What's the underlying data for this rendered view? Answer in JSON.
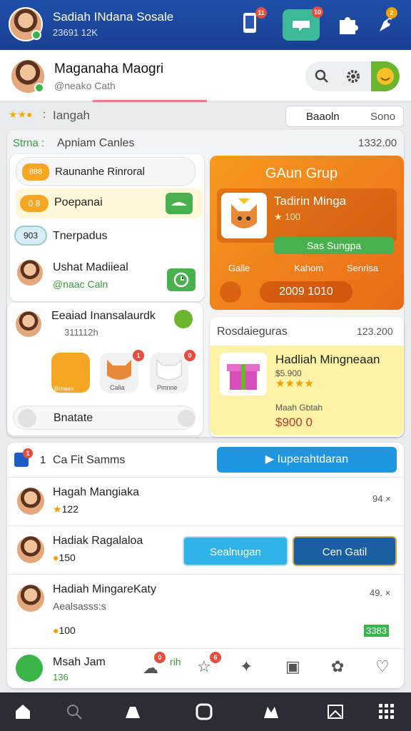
{
  "header": {
    "user_name": "Sadiah INdana Sosale",
    "user_sub": "23691 12K",
    "badges": [
      "11",
      "10",
      "2"
    ]
  },
  "profile": {
    "name": "Maganaha Maogri",
    "sub": "@neako Cath"
  },
  "filter": {
    "label": "Iangah",
    "tab_left": "Baaoln",
    "tab_right": "Sono"
  },
  "panel": {
    "title_green": "Strna :",
    "title": "Apniam Canles",
    "count": "1332.00",
    "items": [
      {
        "label": "Raunanhe Rinroral",
        "chip": "888"
      },
      {
        "label": "Poepanai",
        "chip": "0 8"
      },
      {
        "label": "Tnerpadus",
        "chip": "903"
      },
      {
        "label": "Ushat Madiieal",
        "sub": "@naac Caln"
      }
    ]
  },
  "promo": {
    "title": "GAun Grup",
    "item_title": "Tadirin Minga",
    "item_stars": "★ 100",
    "btn": "Sas Sungpa",
    "tags": [
      "Galle",
      "Kahom",
      "Senrisa"
    ],
    "amount": "2009 1010"
  },
  "people": {
    "name": "Eeaiad Inansalaurdk",
    "sub": "311112h",
    "pets": [
      "Bcnaau",
      "Calia",
      "Pmnne"
    ],
    "pet_badges": [
      "1",
      "0"
    ],
    "footer": "Bnatate"
  },
  "reward": {
    "title": "Rosdaieguras",
    "count": "123.200",
    "name": "Hadliah Mingneaan",
    "price_old": "$5.900",
    "sub": "Maah Gbtah",
    "price": "$900 0"
  },
  "list": {
    "head_icon_num": "1",
    "head_num": "1",
    "head_label": "Ca Fit Samms",
    "head_btn": "Iuperahtdaran",
    "rows": [
      {
        "name": "Hagah Mangiaka",
        "score": "122",
        "right": "94 ×"
      },
      {
        "name": "Hadiak Ragalaloa",
        "score": "150",
        "btn1": "Sealnugan",
        "btn2": "Cen Gatil"
      },
      {
        "name": "Hadiah MingareKaty",
        "sub": "Aealsasss:s",
        "score": "100",
        "right": "49. ×",
        "tag": "3383"
      }
    ]
  },
  "bottom_strip": {
    "name": "Msah Jam",
    "sub": "136",
    "link": "rih",
    "badges": [
      "0",
      "6"
    ]
  },
  "nav": {
    "items": [
      "home-icon",
      "search-icon",
      "shop-icon",
      "camera-icon",
      "store-icon",
      "image-icon",
      "grid-icon"
    ]
  }
}
